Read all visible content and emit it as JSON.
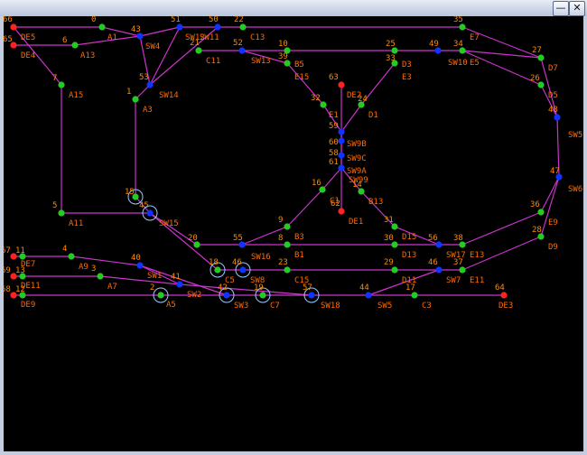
{
  "window": {
    "title": "",
    "minimize_icon": "minimize-icon",
    "close_icon": "close-icon",
    "minimize_glyph": "—",
    "close_glyph": "✕"
  },
  "colors": {
    "background": "#000000",
    "track": "#cc33cc",
    "node_green": "#22cc22",
    "node_blue": "#1133ff",
    "node_red": "#ff2222",
    "label": "#ff7700",
    "ring": "#9ac8ff"
  },
  "diagram": {
    "nodes": [
      {
        "id": "66",
        "label": "66",
        "name": "DE5",
        "kind": "red"
      },
      {
        "id": "65",
        "label": "65",
        "name": "DE4",
        "kind": "red"
      },
      {
        "id": "0",
        "label": "0",
        "name": "A1",
        "kind": "green"
      },
      {
        "id": "6",
        "label": "6",
        "name": "A13",
        "kind": "green"
      },
      {
        "id": "43",
        "label": "43",
        "name": "SW4",
        "kind": "blue"
      },
      {
        "id": "51",
        "label": "51",
        "name": "SW12",
        "kind": "blue"
      },
      {
        "id": "50",
        "label": "50",
        "name": "SW11",
        "kind": "blue"
      },
      {
        "id": "22",
        "label": "22",
        "name": "C13",
        "kind": "green"
      },
      {
        "id": "35",
        "label": "35",
        "name": "E7",
        "kind": "green"
      },
      {
        "id": "21",
        "label": "21",
        "name": "C11",
        "kind": "green"
      },
      {
        "id": "52",
        "label": "52",
        "name": "SW13",
        "kind": "blue"
      },
      {
        "id": "10",
        "label": "10",
        "name": "",
        "kind": "green"
      },
      {
        "id": "39",
        "label": "39",
        "name": "B5",
        "kind": "green"
      },
      {
        "id": "25",
        "label": "25",
        "name": "",
        "kind": "green"
      },
      {
        "id": "49",
        "label": "49",
        "name": "",
        "kind": "blue"
      },
      {
        "id": "34",
        "label": "34",
        "name": "",
        "kind": "green"
      },
      {
        "id": "33",
        "label": "33",
        "name": "D3",
        "kind": "green"
      },
      {
        "id": "E5",
        "label": "",
        "name": "E5",
        "kind": "none"
      },
      {
        "id": "SW10",
        "label": "",
        "name": "SW10",
        "kind": "none"
      },
      {
        "id": "27",
        "label": "27",
        "name": "D7",
        "kind": "green"
      },
      {
        "id": "7",
        "label": "7",
        "name": "A15",
        "kind": "green"
      },
      {
        "id": "53",
        "label": "53",
        "name": "SW14",
        "kind": "blue"
      },
      {
        "id": "E15",
        "label": "",
        "name": "E15",
        "kind": "none"
      },
      {
        "id": "E3",
        "label": "",
        "name": "E3",
        "kind": "none"
      },
      {
        "id": "26",
        "label": "26",
        "name": "D5",
        "kind": "green"
      },
      {
        "id": "1",
        "label": "1",
        "name": "A3",
        "kind": "green"
      },
      {
        "id": "63",
        "label": "63",
        "name": "DE2",
        "kind": "red"
      },
      {
        "id": "32",
        "label": "32",
        "name": "E1",
        "kind": "green"
      },
      {
        "id": "24",
        "label": "24",
        "name": "D1",
        "kind": "green"
      },
      {
        "id": "48",
        "label": "48",
        "name": "SW5",
        "kind": "blue"
      },
      {
        "id": "59",
        "label": "59",
        "name": "",
        "kind": "blue"
      },
      {
        "id": "60",
        "label": "60",
        "name": "SW9B",
        "kind": "blue"
      },
      {
        "id": "58",
        "label": "58",
        "name": "SW9C",
        "kind": "blue"
      },
      {
        "id": "61",
        "label": "61",
        "name": "SW9A",
        "kind": "blue"
      },
      {
        "id": "SW99",
        "label": "",
        "name": "SW99",
        "kind": "none"
      },
      {
        "id": "47",
        "label": "47",
        "name": "SW6",
        "kind": "blue"
      },
      {
        "id": "16",
        "label": "16",
        "name": "C1",
        "kind": "green"
      },
      {
        "id": "14",
        "label": "14",
        "name": "B13",
        "kind": "green"
      },
      {
        "id": "62",
        "label": "62",
        "name": "DE1",
        "kind": "red"
      },
      {
        "id": "15",
        "label": "15",
        "name": "",
        "kind": "green"
      },
      {
        "id": "5",
        "label": "5",
        "name": "A11",
        "kind": "green"
      },
      {
        "id": "45",
        "label": "45",
        "name": "SW15",
        "kind": "blue"
      },
      {
        "id": "36",
        "label": "36",
        "name": "E9",
        "kind": "green"
      },
      {
        "id": "9",
        "label": "9",
        "name": "B3",
        "kind": "green"
      },
      {
        "id": "31",
        "label": "31",
        "name": "D15",
        "kind": "green"
      },
      {
        "id": "20",
        "label": "20",
        "name": "",
        "kind": "green"
      },
      {
        "id": "55",
        "label": "55",
        "name": "SW16",
        "kind": "blue"
      },
      {
        "id": "8",
        "label": "8",
        "name": "B1",
        "kind": "green"
      },
      {
        "id": "30",
        "label": "30",
        "name": "D13",
        "kind": "green"
      },
      {
        "id": "56",
        "label": "56",
        "name": "SW17",
        "kind": "blue"
      },
      {
        "id": "38",
        "label": "38",
        "name": "E13",
        "kind": "green"
      },
      {
        "id": "28",
        "label": "28",
        "name": "D9",
        "kind": "green"
      },
      {
        "id": "67",
        "label": "67",
        "name": "DE7",
        "kind": "red"
      },
      {
        "id": "11",
        "label": "11",
        "name": "",
        "kind": "green"
      },
      {
        "id": "4",
        "label": "4",
        "name": "A9",
        "kind": "green"
      },
      {
        "id": "40",
        "label": "40",
        "name": "SW1",
        "kind": "blue"
      },
      {
        "id": "69",
        "label": "69",
        "name": "DE11",
        "kind": "red"
      },
      {
        "id": "13",
        "label": "13",
        "name": "",
        "kind": "green"
      },
      {
        "id": "3",
        "label": "3",
        "name": "A7",
        "kind": "green"
      },
      {
        "id": "41",
        "label": "41",
        "name": "SW2",
        "kind": "blue"
      },
      {
        "id": "18",
        "label": "18",
        "name": "C5",
        "kind": "green"
      },
      {
        "id": "46_top",
        "label": "46",
        "name": "SW8",
        "kind": "blue"
      },
      {
        "id": "23",
        "label": "23",
        "name": "C15",
        "kind": "green"
      },
      {
        "id": "29",
        "label": "29",
        "name": "D11",
        "kind": "green"
      },
      {
        "id": "46",
        "label": "46",
        "name": "SW7",
        "kind": "blue"
      },
      {
        "id": "37",
        "label": "37",
        "name": "E11",
        "kind": "green"
      },
      {
        "id": "68",
        "label": "68",
        "name": "DE9",
        "kind": "red"
      },
      {
        "id": "12",
        "label": "12",
        "name": "",
        "kind": "green"
      },
      {
        "id": "2",
        "label": "2",
        "name": "A5",
        "kind": "green"
      },
      {
        "id": "42",
        "label": "42",
        "name": "SW3",
        "kind": "blue"
      },
      {
        "id": "19",
        "label": "19",
        "name": "C7",
        "kind": "green"
      },
      {
        "id": "57",
        "label": "57",
        "name": "SW18",
        "kind": "blue"
      },
      {
        "id": "44",
        "label": "44",
        "name": "SW5",
        "kind": "blue"
      },
      {
        "id": "17",
        "label": "17",
        "name": "C3",
        "kind": "green"
      },
      {
        "id": "64",
        "label": "64",
        "name": "DE3",
        "kind": "red"
      }
    ]
  }
}
